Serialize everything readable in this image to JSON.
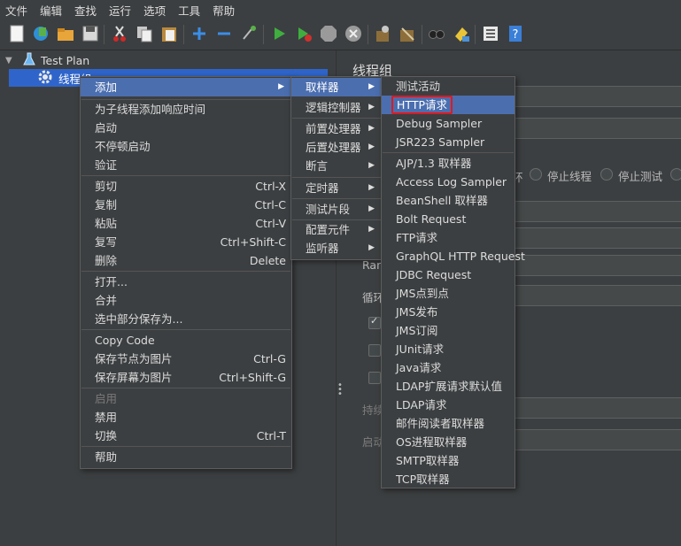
{
  "menubar": {
    "items": [
      "文件",
      "编辑",
      "查找",
      "运行",
      "选项",
      "工具",
      "帮助"
    ]
  },
  "toolbar": {
    "icons": [
      "new-icon",
      "templates-icon",
      "open-icon",
      "save-icon",
      "cut-icon",
      "copy-icon",
      "paste-icon",
      "expand-icon",
      "collapse-icon",
      "toggle-icon",
      "start-icon",
      "start-no-pauses-icon",
      "stop-icon",
      "shutdown-icon",
      "clear-icon",
      "clear-all-icon",
      "search-icon",
      "reset-search-icon",
      "function-helper-icon",
      "help-icon"
    ]
  },
  "tree": {
    "root_label": "Test Plan",
    "child_label": "线程组"
  },
  "right_panel": {
    "title": "线程组",
    "option_labels": [
      "停止线程",
      "停止测试"
    ],
    "partial_labels": [
      "环",
      "Ram",
      "循环",
      "持续",
      "启动"
    ]
  },
  "context_menu": {
    "add_label": "添加",
    "add_response_time": "为子线程添加响应时间",
    "start": "启动",
    "start_no_pause": "不停顿启动",
    "validate": "验证",
    "cut": "剪切",
    "cut_sc": "Ctrl-X",
    "copy": "复制",
    "copy_sc": "Ctrl-C",
    "paste": "粘贴",
    "paste_sc": "Ctrl-V",
    "duplicate": "复写",
    "duplicate_sc": "Ctrl+Shift-C",
    "delete": "删除",
    "delete_sc": "Delete",
    "open": "打开...",
    "merge": "合并",
    "save_selection": "选中部分保存为...",
    "copy_code": "Copy Code",
    "save_node_img": "保存节点为图片",
    "save_node_img_sc": "Ctrl-G",
    "save_screen_img": "保存屏幕为图片",
    "save_screen_img_sc": "Ctrl+Shift-G",
    "enable": "启用",
    "disable": "禁用",
    "toggle": "切换",
    "toggle_sc": "Ctrl-T",
    "help": "帮助"
  },
  "add_submenu": {
    "sampler": "取样器",
    "logic_controller": "逻辑控制器",
    "pre_processor": "前置处理器",
    "post_processor": "后置处理器",
    "assertion": "断言",
    "timer": "定时器",
    "test_fragment": "测试片段",
    "config_element": "配置元件",
    "listener": "监听器"
  },
  "sampler_submenu": {
    "items": [
      "测试活动",
      "HTTP请求",
      "Debug Sampler",
      "JSR223 Sampler",
      "AJP/1.3 取样器",
      "Access Log Sampler",
      "BeanShell 取样器",
      "Bolt Request",
      "FTP请求",
      "GraphQL HTTP Request",
      "JDBC Request",
      "JMS点到点",
      "JMS发布",
      "JMS订阅",
      "JUnit请求",
      "Java请求",
      "LDAP扩展请求默认值",
      "LDAP请求",
      "邮件阅读者取样器",
      "OS进程取样器",
      "SMTP取样器",
      "TCP取样器"
    ]
  },
  "colors": {
    "selection": "#4b6eaf",
    "highlight_box": "#e0191f",
    "background": "#3c3f41"
  }
}
